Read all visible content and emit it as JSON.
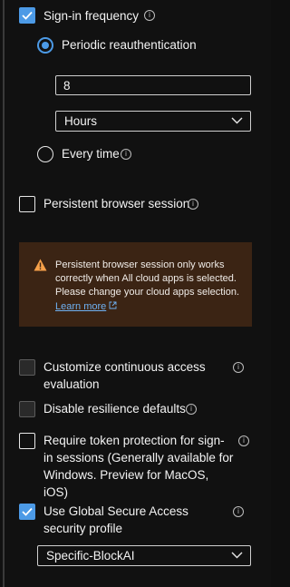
{
  "signin_frequency": {
    "label": "Sign-in frequency",
    "checked": true,
    "periodic": {
      "label": "Periodic reauthentication",
      "selected": true,
      "value": "8",
      "unit": "Hours"
    },
    "every_time": {
      "label": "Every time",
      "selected": false
    }
  },
  "persistent_session": {
    "label": "Persistent browser session",
    "checked": false,
    "warning": {
      "text": "Persistent browser session only works correctly when All cloud apps is selected. Please change your cloud apps selection.",
      "link_label": "Learn more"
    }
  },
  "continuous_access": {
    "label": "Customize continuous access evaluation",
    "checked": false
  },
  "resilience": {
    "label": "Disable resilience defaults",
    "checked": false
  },
  "token_protection": {
    "label": "Require token protection for sign-in sessions (Generally available for Windows. Preview for MacOS, iOS)",
    "checked": false
  },
  "global_secure_access": {
    "label": "Use Global Secure Access security profile",
    "checked": true,
    "profile": "Specific-BlockAI"
  },
  "colors": {
    "accent": "#4c9ae6",
    "warning_bg": "#3b2414",
    "warning_icon": "#f7a14a",
    "link": "#6fb1f2"
  }
}
